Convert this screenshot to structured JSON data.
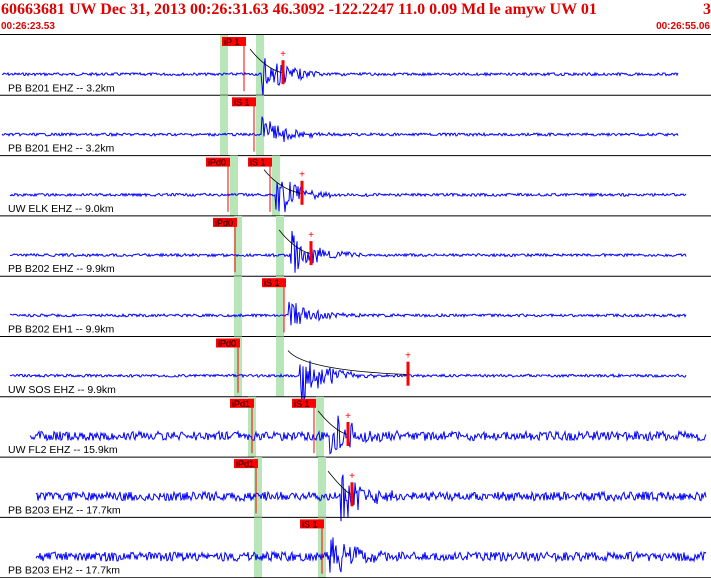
{
  "header": {
    "title": "60663681 UW Dec 31, 2013 00:26:31.63    46.3092 -122.2247 11.0 0.09 Md le amyw UW 01",
    "right_value": "3"
  },
  "time_start": "00:26:23.53",
  "time_end": "00:26:55.06",
  "colors": {
    "header_text": "#e00000",
    "trace": "#0000ff",
    "pick_box": "#ff0000",
    "pick_window": "#b9e6b9",
    "separator": "#000000"
  },
  "traces": [
    {
      "label": "PB B201 EHZ -- 3.2km",
      "picks": [
        "iP 1"
      ],
      "amp": 1.0
    },
    {
      "label": "PB B201 EH2 -- 3.2km",
      "picks": [
        "iS 1"
      ],
      "amp": 0.7
    },
    {
      "label": "UW ELK EHZ -- 9.0km",
      "picks": [
        "iPd0",
        "iS 1"
      ],
      "amp": 1.0
    },
    {
      "label": "PB B202 EHZ -- 9.9km",
      "picks": [
        "iPd0"
      ],
      "amp": 1.0
    },
    {
      "label": "PB B202 EH1 -- 9.9km",
      "picks": [
        "iS 1"
      ],
      "amp": 0.6
    },
    {
      "label": "UW SOS EHZ -- 9.9km",
      "picks": [
        "iPd0"
      ],
      "amp": 1.2
    },
    {
      "label": "UW FL2 EHZ -- 15.9km",
      "picks": [
        "iPd1",
        "iS 1"
      ],
      "amp": 1.0
    },
    {
      "label": "PB B203 EHZ -- 17.7km",
      "picks": [
        "iPd1"
      ],
      "amp": 1.0
    },
    {
      "label": "PB B203 EH2 -- 17.7km",
      "picks": [
        "iS 1"
      ],
      "amp": 1.0
    }
  ]
}
